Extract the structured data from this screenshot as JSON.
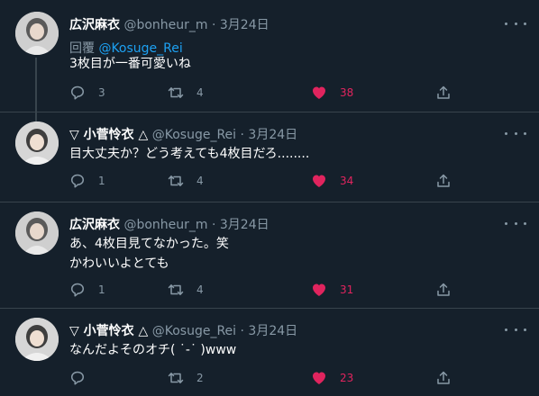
{
  "tweets": [
    {
      "name": "広沢麻衣",
      "handle": "@bonheur_m",
      "sep": "·",
      "date": "3月24日",
      "reply_prefix": "回覆",
      "reply_handle": "@Kosuge_Rei",
      "text": "3枚目が一番可愛いね",
      "replies": "3",
      "retweets": "4",
      "likes": "38"
    },
    {
      "name": "▽ 小菅怜衣 △",
      "handle": "@Kosuge_Rei",
      "sep": "·",
      "date": "3月24日",
      "text": "目大丈夫か？どう考えても4枚目だろ........",
      "replies": "1",
      "retweets": "4",
      "likes": "34"
    },
    {
      "name": "広沢麻衣",
      "handle": "@bonheur_m",
      "sep": "·",
      "date": "3月24日",
      "text": "あ、4枚目見てなかった。笑\nかわいいよとても",
      "replies": "1",
      "retweets": "4",
      "likes": "31"
    },
    {
      "name": "▽ 小菅怜衣 △",
      "handle": "@Kosuge_Rei",
      "sep": "·",
      "date": "3月24日",
      "text": "なんだよそのオチ( ˙-˙ )www",
      "replies": "",
      "retweets": "2",
      "likes": "23"
    }
  ],
  "colors": {
    "background": "#15202b",
    "secondary_text": "#8899a6",
    "link": "#1da1f2",
    "like": "#e0245e",
    "divider": "#38444d"
  },
  "icons": {
    "reply": "reply-icon",
    "retweet": "retweet-icon",
    "like": "heart-icon",
    "share": "share-icon",
    "more": "more-icon"
  }
}
